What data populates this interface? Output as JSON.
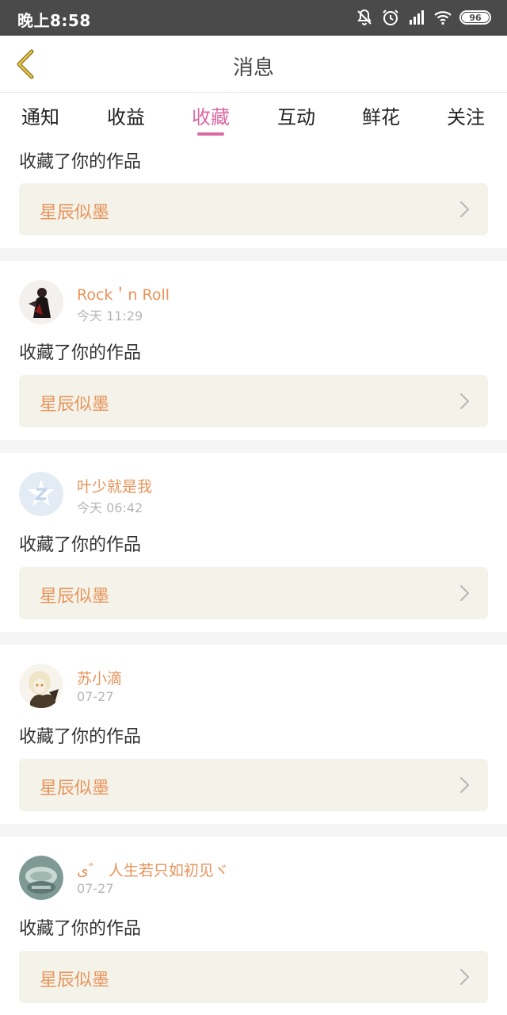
{
  "status_bar": {
    "time": "晚上8:58",
    "battery": "96"
  },
  "header": {
    "title": "消息"
  },
  "tabs": [
    {
      "label": "通知"
    },
    {
      "label": "收益"
    },
    {
      "label": "收藏"
    },
    {
      "label": "互动"
    },
    {
      "label": "鲜花"
    },
    {
      "label": "关注"
    }
  ],
  "active_tab": "收藏",
  "colors": {
    "accent": "#d96aa2",
    "highlight": "#e8935a",
    "work_box_bg": "#f4f3ea"
  },
  "feed": {
    "first_partial": {
      "action": "收藏了你的作品",
      "work_title": "星辰似墨"
    },
    "items": [
      {
        "username": "Rock＇n Roll",
        "time": "今天 11:29",
        "action": "收藏了你的作品",
        "work_title": "星辰似墨"
      },
      {
        "username": "叶少就是我",
        "time": "今天 06:42",
        "action": "收藏了你的作品",
        "work_title": "星辰似墨"
      },
      {
        "username": "苏小滴",
        "time": "07-27",
        "action": "收藏了你的作品",
        "work_title": "星辰似墨"
      },
      {
        "username": "ى゛ 人生若只如初见ヾ",
        "time": "07-27",
        "action": "收藏了你的作品",
        "work_title": "星辰似墨"
      }
    ]
  }
}
